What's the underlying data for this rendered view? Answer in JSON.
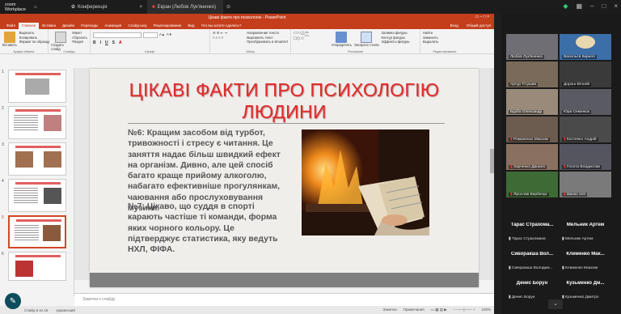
{
  "zoom": {
    "logo_line1": "zoom",
    "logo_line2": "Workplace",
    "tab_conference": "Конференція",
    "tab_share": "Екран (Любов Лук'яненко)"
  },
  "ppt": {
    "window_title": "Цікаві факти про психологію - PowerPoint",
    "sign_in": "Вход",
    "share": "Общий доступ",
    "tabs": [
      "Файл",
      "Главная",
      "Вставка",
      "Дизайн",
      "Переходы",
      "Анимация",
      "Слайд-шоу",
      "Рецензирование",
      "Вид",
      "Что вы хотите сделать?"
    ],
    "ribbon": {
      "clipboard": {
        "label": "Буфер обмена",
        "items": [
          "Вырезать",
          "Копировать",
          "Формат по образцу"
        ],
        "paste": "Вставить"
      },
      "slides": {
        "label": "Слайды",
        "items": [
          "Макет",
          "Сбросить",
          "Раздел"
        ],
        "new": "Создать слайд"
      },
      "font": {
        "label": "Шрифт"
      },
      "paragraph": {
        "label": "Абзац",
        "items": [
          "Направление текста",
          "Выровнять текст",
          "Преобразовать в SmartArt"
        ]
      },
      "drawing": {
        "label": "Рисование",
        "items": [
          "Упорядочить",
          "Экспресс-стили",
          "Заливка фигуры",
          "Контур фигуры",
          "Эффекты фигуры"
        ]
      },
      "editing": {
        "label": "Редактирование",
        "items": [
          "Найти",
          "Заменить",
          "Выделить"
        ]
      }
    },
    "slide_numbers": [
      "1",
      "2",
      "3",
      "4",
      "5",
      "6"
    ],
    "slide": {
      "title": "ЦІКАВІ ФАКТИ ПРО ПСИХОЛОГІЮ ЛЮДИНИ",
      "p1": "№6: Кращим засобом від турбот, тривожності і стресу є читання. Це заняття надає більш швидкий ефект на організм. Дивно, але цей спосіб багато краще прийому алкоголю, набагато ефективніше прогулянкам, чаювання або прослуховування музики.",
      "p2": "№7: Цікаво, що суддя в спорті карають частіше ті команди, форма яких чорного кольору. Це підтверджує статистика, яку ведуть НХЛ, ФІФА."
    },
    "notes_placeholder": "Заметки к слайду",
    "status": {
      "slide": "Слайд 5 из 16",
      "lang": "украинский",
      "notes": "Заметки",
      "comments": "Примечания",
      "zoom": "100%"
    }
  },
  "gallery": {
    "tiles": [
      {
        "name": "Любов Лук'яненко"
      },
      {
        "name": "Васильєв Кирило"
      },
      {
        "name": "Артур Тітушин"
      },
      {
        "name": "Дорош Віталій"
      },
      {
        "name": "Бурба Олександр"
      },
      {
        "name": "Юра Семенюк"
      },
      {
        "name": "Романенко Максим"
      },
      {
        "name": "Костенко Андрій"
      },
      {
        "name": "Харченко Данило"
      },
      {
        "name": "Голота Владислав"
      },
      {
        "name": "Ярослав Вербичук"
      },
      {
        "name": "іванко оля"
      }
    ],
    "name_tiles": [
      {
        "big": "Тарас Страхома...",
        "name": "Тарас Страхомана"
      },
      {
        "big": "Мельник Артем",
        "name": "Мельник Артем"
      },
      {
        "big": "Сиворакша Вол...",
        "name": "Сиворакша Володим..."
      },
      {
        "big": "Клименко Мак...",
        "name": "Клименко Максим"
      },
      {
        "big": "Денис Борун",
        "name": "Денис Борун"
      },
      {
        "big": "Кузьменко Дм...",
        "name": "Кузьменко Дмитро"
      }
    ]
  }
}
